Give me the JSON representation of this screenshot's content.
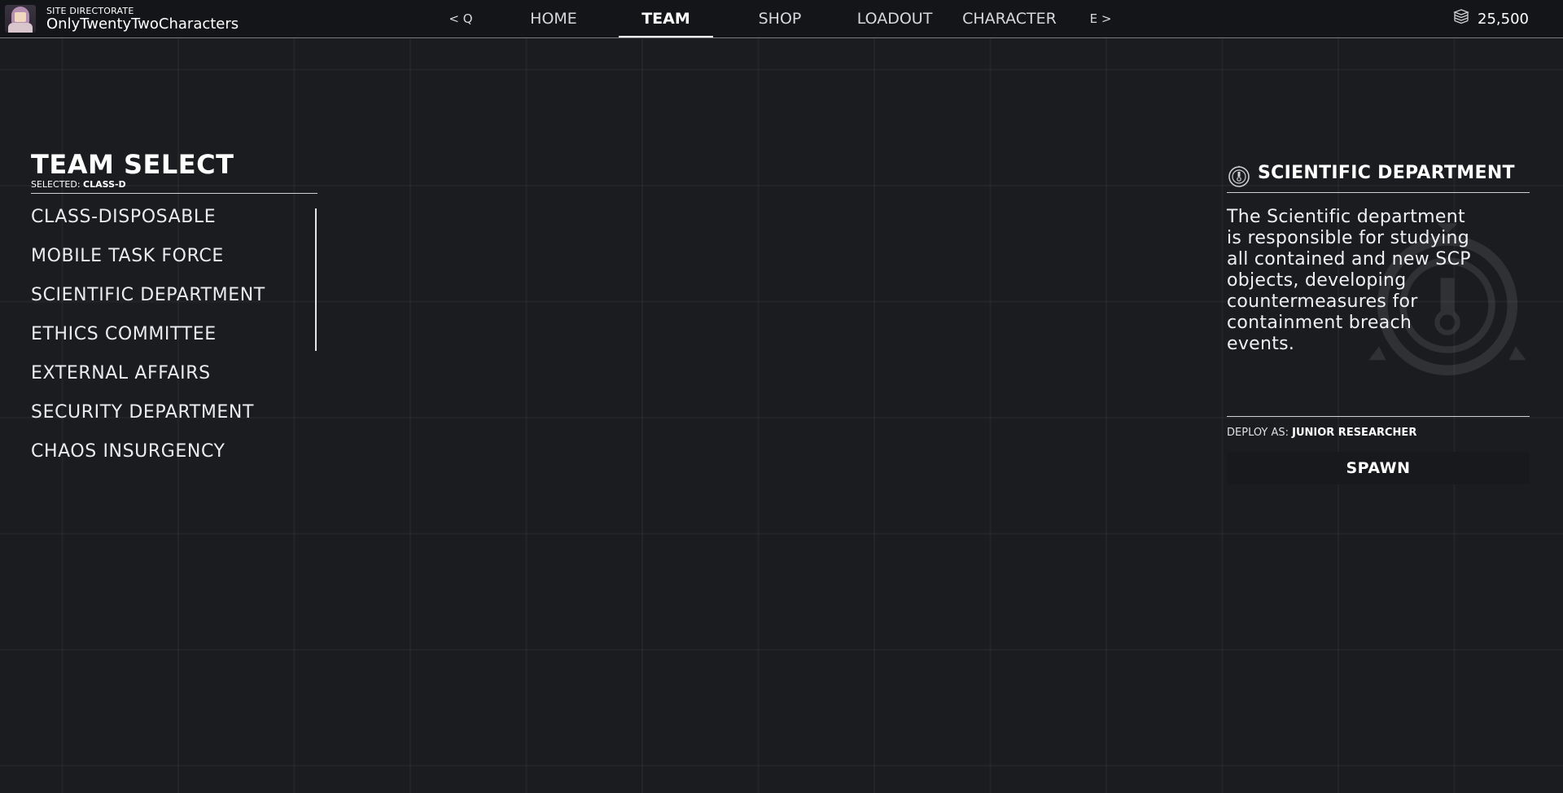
{
  "profile": {
    "site_label": "SITE DIRECTORATE",
    "username": "OnlyTwentyTwoCharacters",
    "avatar_icon": "avatar-icon"
  },
  "nav": {
    "prev_hint": "< Q",
    "next_hint": "E >",
    "tabs": [
      {
        "label": "HOME",
        "active": false
      },
      {
        "label": "TEAM",
        "active": true
      },
      {
        "label": "SHOP",
        "active": false
      },
      {
        "label": "LOADOUT",
        "active": false
      },
      {
        "label": "CHARACTER",
        "active": false
      }
    ]
  },
  "currency": {
    "icon": "cash-stack-icon",
    "amount": "25,500"
  },
  "team_select": {
    "title": "TEAM SELECT",
    "selected_prefix": "SELECTED:",
    "selected_value": "CLASS-D",
    "teams": [
      "CLASS-DISPOSABLE",
      "MOBILE TASK FORCE",
      "SCIENTIFIC DEPARTMENT",
      "ETHICS COMMITTEE",
      "EXTERNAL AFFAIRS",
      "SECURITY DEPARTMENT",
      "CHAOS INSURGENCY"
    ]
  },
  "detail": {
    "icon": "scientific-department-emblem-icon",
    "title": "SCIENTIFIC DEPARTMENT",
    "description": "The Scientific department is responsible for studying all contained and new SCP objects, developing countermeasures for containment breach events.",
    "deploy_prefix": "DEPLOY AS:",
    "deploy_role": "JUNIOR RESEARCHER",
    "spawn_label": "SPAWN"
  }
}
